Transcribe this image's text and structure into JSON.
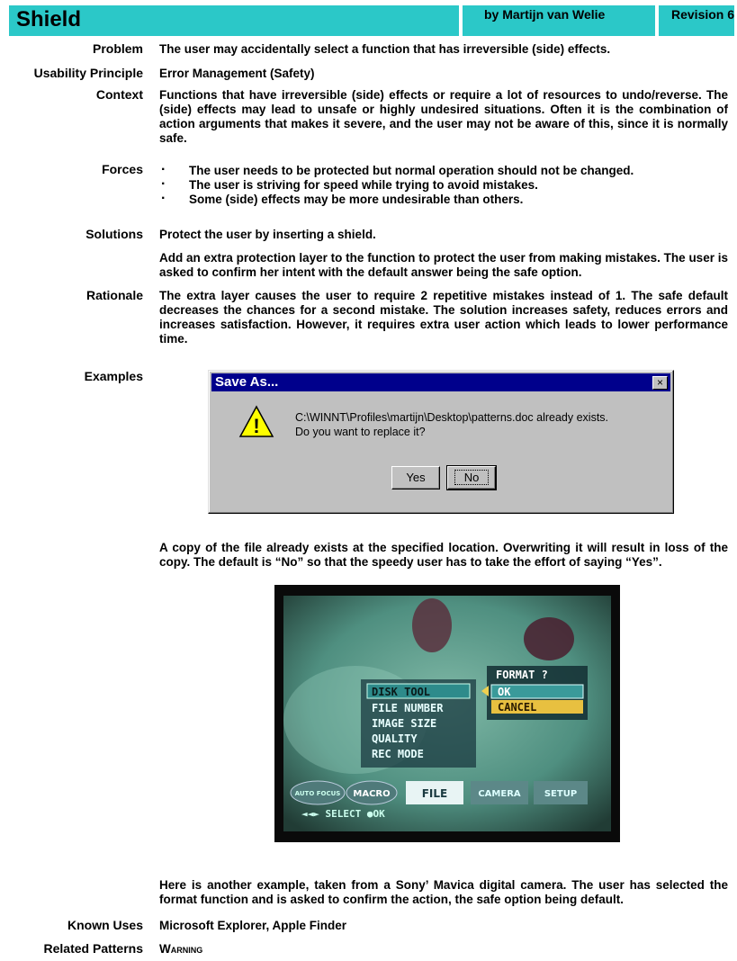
{
  "header": {
    "title": "Shield",
    "author": "by Martijn van Welie",
    "revision": "Revision 6"
  },
  "sections": {
    "problem": {
      "label": "Problem",
      "text": "The user may accidentally select a function that has irreversible (side) effects."
    },
    "principle": {
      "label": "Usability Principle",
      "text": "Error Management (Safety)"
    },
    "context": {
      "label": "Context",
      "text": "Functions that have irreversible (side) effects or require a lot of resources to undo/reverse. The (side) effects may lead to unsafe or highly undesired situations. Often it is the combination of action arguments that makes it severe, and the user may not be aware of this, since it is normally safe."
    },
    "forces": {
      "label": "Forces",
      "items": [
        "The user needs to be protected but normal operation should not be changed.",
        "The user is striving for speed while trying to avoid mistakes.",
        "Some (side) effects may be more undesirable than others."
      ]
    },
    "solutions": {
      "label": "Solutions",
      "text": "Protect the user by inserting a shield.",
      "text2": "Add an extra protection layer to the function to protect the user from making mistakes. The user is asked to confirm her intent with the default answer being the safe option."
    },
    "rationale": {
      "label": "Rationale",
      "text": "The extra layer causes the user to require 2 repetitive mistakes instead of 1. The safe default decreases the chances for a second mistake. The solution increases safety, reduces errors and increases satisfaction. However, it requires extra user action which leads to lower performance time."
    },
    "examples": {
      "label": "Examples",
      "caption1": "A copy of the file already exists at the specified location. Overwriting it will result in loss of the copy. The default is “No” so that the speedy user has to take the effort of saying “Yes”.",
      "caption2": "Here is another example, taken from a Sony’ Mavica digital camera. The user has selected the format function and is asked to confirm the action, the safe option being default."
    },
    "known_uses": {
      "label": "Known Uses",
      "text": "Microsoft Explorer, Apple Finder"
    },
    "related": {
      "label": "Related Patterns",
      "text": "Warning"
    }
  },
  "dialog": {
    "title": "Save As...",
    "message_line1": "C:\\WINNT\\Profiles\\martijn\\Desktop\\patterns.doc already exists.",
    "message_line2": "Do you want to replace it?",
    "yes_label": "Yes",
    "no_label": "No",
    "close_glyph": "×",
    "warning_glyph": "!",
    "title_bar_color": "#00008c",
    "icon": "warning-icon"
  },
  "camera": {
    "prompt": "FORMAT ?",
    "options": [
      "OK",
      "CANCEL"
    ],
    "menu_items": [
      "DISK TOOL",
      "FILE NUMBER",
      "IMAGE SIZE",
      "QUALITY",
      "REC MODE"
    ],
    "tabs": [
      "AUTO FOCUS",
      "MACRO",
      "FILE",
      "CAMERA",
      "SETUP"
    ],
    "footer": "◄◄► SELECT ●OK",
    "selected_option_color": "#e8c040"
  },
  "colors": {
    "header": "#2bc8c8"
  }
}
